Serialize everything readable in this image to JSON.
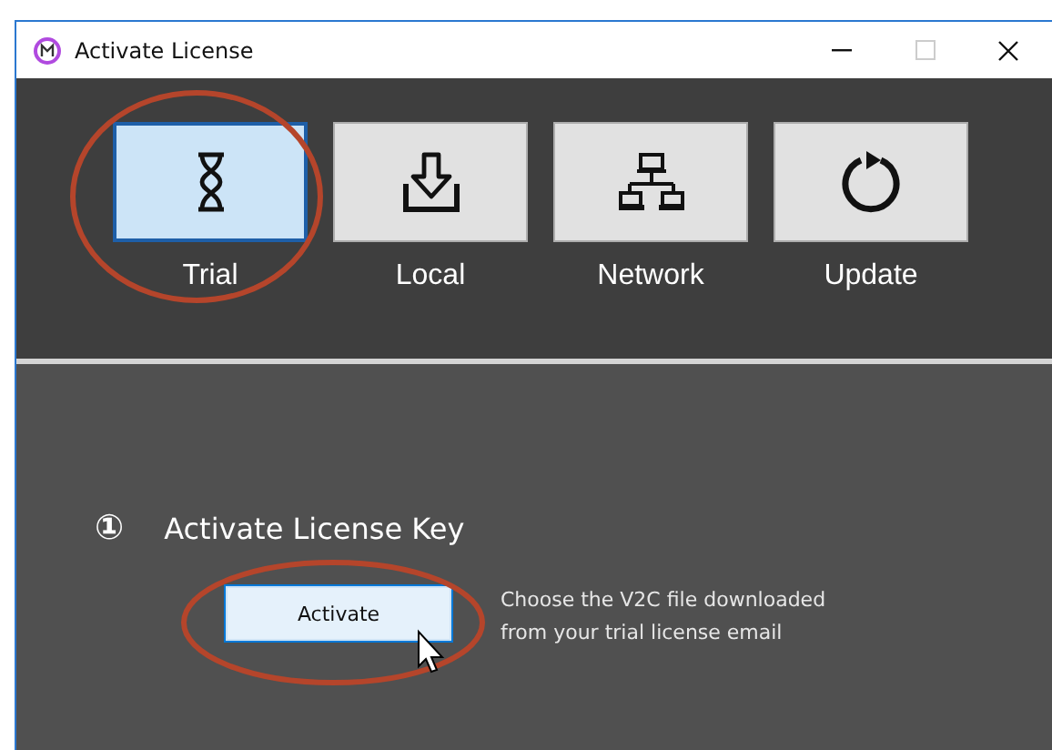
{
  "window": {
    "title": "Activate License"
  },
  "tabs": [
    {
      "label": "Trial",
      "kind": "hourglass",
      "selected": true
    },
    {
      "label": "Local",
      "kind": "download",
      "selected": false
    },
    {
      "label": "Network",
      "kind": "network",
      "selected": false
    },
    {
      "label": "Update",
      "kind": "refresh",
      "selected": false
    }
  ],
  "step": {
    "number": "①",
    "title": "Activate License Key",
    "button": "Activate",
    "description": "Choose the V2C file downloaded from your trial license email"
  }
}
